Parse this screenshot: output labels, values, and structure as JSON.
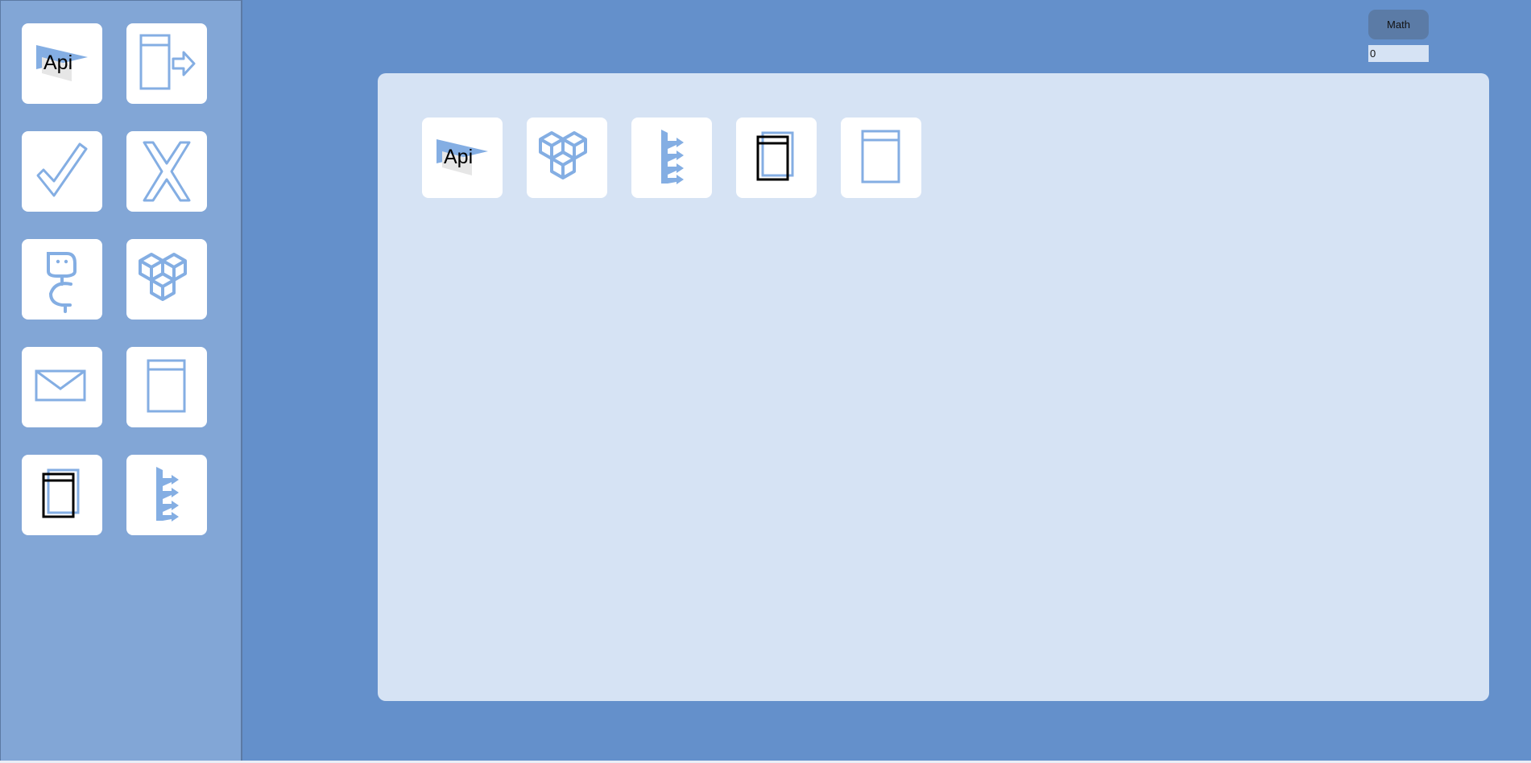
{
  "colors": {
    "background": "#6490cb",
    "sidebar": "#82a6d6",
    "canvas": "#d6e3f4",
    "tile": "#ffffff",
    "icon_stroke": "#84aee3",
    "button": "#5b7ba6"
  },
  "palette": {
    "items": [
      {
        "icon": "api-icon",
        "text": "Api"
      },
      {
        "icon": "page-arrow-icon"
      },
      {
        "icon": "checkmark-icon"
      },
      {
        "icon": "cross-icon"
      },
      {
        "icon": "plug-connector-icon"
      },
      {
        "icon": "cubes-icon"
      },
      {
        "icon": "envelope-icon"
      },
      {
        "icon": "page-icon"
      },
      {
        "icon": "stacked-pages-icon"
      },
      {
        "icon": "multi-arrow-icon"
      }
    ]
  },
  "canvas": {
    "items": [
      {
        "icon": "api-icon",
        "text": "Api"
      },
      {
        "icon": "cubes-icon"
      },
      {
        "icon": "multi-arrow-icon"
      },
      {
        "icon": "stacked-pages-icon"
      },
      {
        "icon": "page-icon"
      }
    ]
  },
  "controls": {
    "math_label": "Math",
    "math_value": "0"
  }
}
